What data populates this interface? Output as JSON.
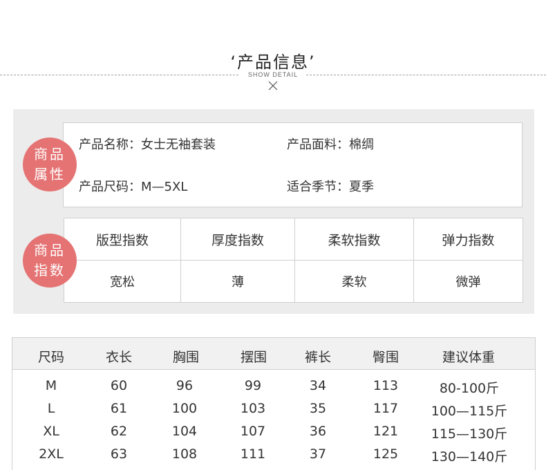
{
  "header": {
    "title": "‘产品信息’",
    "subtitle": "SHOW DETAIL",
    "close_icon": "close-icon"
  },
  "attributes": {
    "badge_line1": "商品",
    "badge_line2": "属性",
    "items": [
      {
        "label": "产品名称：",
        "value": "女士无袖套装"
      },
      {
        "label": "产品面料：",
        "value": "棉绸"
      },
      {
        "label": "产品尺码：",
        "value": "M—5XL"
      },
      {
        "label": "适合季节：",
        "value": "夏季"
      }
    ]
  },
  "indices": {
    "badge_line1": "商品",
    "badge_line2": "指数",
    "headers": [
      "版型指数",
      "厚度指数",
      "柔软指数",
      "弹力指数"
    ],
    "values": [
      "宽松",
      "薄",
      "柔软",
      "微弹"
    ]
  },
  "size_table": {
    "columns": [
      "尺码",
      "衣长",
      "胸围",
      "摆围",
      "裤长",
      "臀围",
      "建议体重"
    ],
    "rows": [
      [
        "M",
        "60",
        "96",
        "99",
        "34",
        "113",
        "80-100斤"
      ],
      [
        "L",
        "61",
        "100",
        "103",
        "35",
        "117",
        "100—115斤"
      ],
      [
        "XL",
        "62",
        "104",
        "107",
        "36",
        "121",
        "115—130斤"
      ],
      [
        "2XL",
        "63",
        "108",
        "111",
        "37",
        "125",
        "130—140斤"
      ]
    ]
  },
  "colors": {
    "badge": "#e57373",
    "panel": "#ececec",
    "border": "#cfcfcf"
  }
}
